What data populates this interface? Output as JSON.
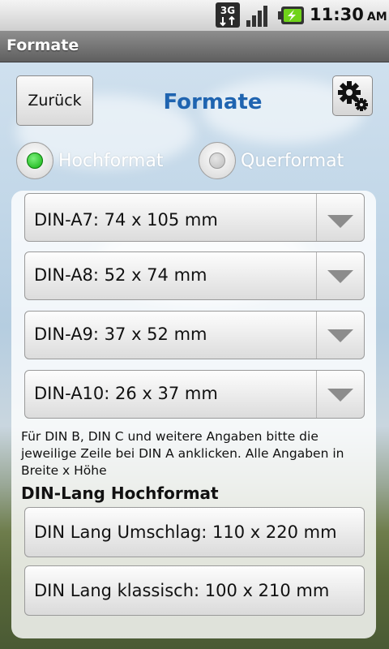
{
  "status_bar": {
    "network": "3G",
    "time": "11:30",
    "ampm": "AM"
  },
  "title_bar": {
    "title": "Formate"
  },
  "header": {
    "back_label": "Zurück",
    "title": "Formate",
    "settings_icon": "gear-icon"
  },
  "orientation": {
    "options": [
      {
        "label": "Hochformat",
        "selected": true
      },
      {
        "label": "Querformat",
        "selected": false
      }
    ]
  },
  "spinners": [
    {
      "label": "DIN-A7: 74 x 105 mm"
    },
    {
      "label": "DIN-A8: 52 x 74 mm"
    },
    {
      "label": "DIN-A9: 37 x 52 mm"
    },
    {
      "label": "DIN-A10: 26 x 37 mm"
    }
  ],
  "info_text": "Für DIN B, DIN C und weitere Angaben bitte die jeweilige Zeile bei DIN A anklicken. Alle Angaben in Breite x Höhe",
  "din_lang": {
    "title": "DIN-Lang Hochformat",
    "items": [
      {
        "label": "DIN Lang Umschlag: 110 x 220 mm"
      },
      {
        "label": "DIN Lang klassisch: 100 x 210 mm"
      }
    ]
  },
  "colors": {
    "title_blue": "#1f64b0",
    "radio_selected": "#10b010"
  }
}
